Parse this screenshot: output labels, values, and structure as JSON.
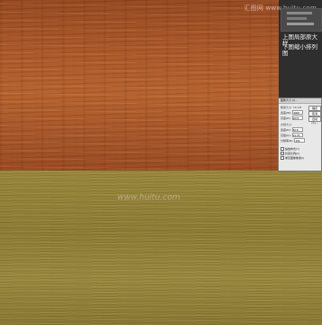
{
  "watermark": {
    "top": "汇图网 www.huitu.com",
    "bottom": "www.huitu.com"
  },
  "captions": {
    "line1": "上图局部原大样",
    "line2": "下图缩小排列图"
  },
  "dialog": {
    "title": "图像大小 (I)...",
    "section1": "像素大小: 16.1M",
    "width_label": "宽度(W):",
    "width_value": "3000",
    "height_label": "高度(H):",
    "height_value": "1875",
    "section2": "文档大小:",
    "doc_width_label": "宽度(D):",
    "doc_width_value": "50.8",
    "doc_height_label": "高度(G):",
    "doc_height_value": "31.75",
    "res_label": "分辨率(R):",
    "res_value": "150",
    "chk1": "缩放样式(Y)",
    "chk2": "约束比例(C)",
    "chk3": "重定图像像素(I)",
    "ok_label": "确定",
    "cancel_label": "取消",
    "auto_label": "自动(A)..."
  }
}
